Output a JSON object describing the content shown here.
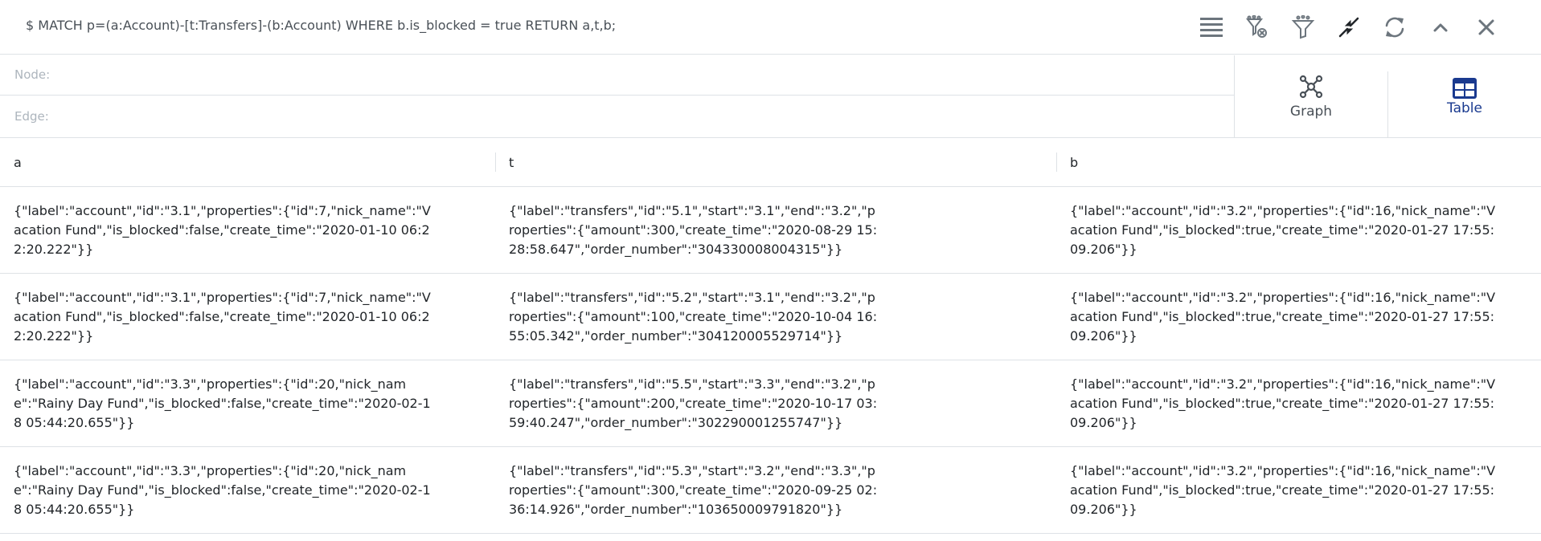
{
  "query": "$ MATCH p=(a:Account)-[t:Transfers]-(b:Account) WHERE b.is_blocked = true RETURN a,t,b;",
  "toolbar": {
    "icons": [
      "list-icon",
      "filter-remove-icon",
      "filter-icon",
      "collapse-icon",
      "refresh-icon",
      "chevron-up-icon",
      "close-icon"
    ]
  },
  "filters": {
    "node_placeholder": "Node:",
    "edge_placeholder": "Edge:"
  },
  "views": {
    "graph_label": "Graph",
    "table_label": "Table",
    "active": "Table",
    "active_color": "#1a3a8f"
  },
  "table": {
    "headers": [
      "a",
      "t",
      "b"
    ],
    "rows": [
      {
        "a": "{\"label\":\"account\",\"id\":\"3.1\",\"properties\":{\"id\":7,\"nick_name\":\"Vacation Fund\",\"is_blocked\":false,\"create_time\":\"2020-01-10 06:22:20.222\"}}",
        "t": "{\"label\":\"transfers\",\"id\":\"5.1\",\"start\":\"3.1\",\"end\":\"3.2\",\"properties\":{\"amount\":300,\"create_time\":\"2020-08-29 15:28:58.647\",\"order_number\":\"304330008004315\"}}",
        "b": "{\"label\":\"account\",\"id\":\"3.2\",\"properties\":{\"id\":16,\"nick_name\":\"Vacation Fund\",\"is_blocked\":true,\"create_time\":\"2020-01-27 17:55:09.206\"}}"
      },
      {
        "a": "{\"label\":\"account\",\"id\":\"3.1\",\"properties\":{\"id\":7,\"nick_name\":\"Vacation Fund\",\"is_blocked\":false,\"create_time\":\"2020-01-10 06:22:20.222\"}}",
        "t": "{\"label\":\"transfers\",\"id\":\"5.2\",\"start\":\"3.1\",\"end\":\"3.2\",\"properties\":{\"amount\":100,\"create_time\":\"2020-10-04 16:55:05.342\",\"order_number\":\"304120005529714\"}}",
        "b": "{\"label\":\"account\",\"id\":\"3.2\",\"properties\":{\"id\":16,\"nick_name\":\"Vacation Fund\",\"is_blocked\":true,\"create_time\":\"2020-01-27 17:55:09.206\"}}"
      },
      {
        "a": "{\"label\":\"account\",\"id\":\"3.3\",\"properties\":{\"id\":20,\"nick_name\":\"Rainy Day Fund\",\"is_blocked\":false,\"create_time\":\"2020-02-18 05:44:20.655\"}}",
        "t": "{\"label\":\"transfers\",\"id\":\"5.5\",\"start\":\"3.3\",\"end\":\"3.2\",\"properties\":{\"amount\":200,\"create_time\":\"2020-10-17 03:59:40.247\",\"order_number\":\"302290001255747\"}}",
        "b": "{\"label\":\"account\",\"id\":\"3.2\",\"properties\":{\"id\":16,\"nick_name\":\"Vacation Fund\",\"is_blocked\":true,\"create_time\":\"2020-01-27 17:55:09.206\"}}"
      },
      {
        "a": "{\"label\":\"account\",\"id\":\"3.3\",\"properties\":{\"id\":20,\"nick_name\":\"Rainy Day Fund\",\"is_blocked\":false,\"create_time\":\"2020-02-18 05:44:20.655\"}}",
        "t": "{\"label\":\"transfers\",\"id\":\"5.3\",\"start\":\"3.2\",\"end\":\"3.3\",\"properties\":{\"amount\":300,\"create_time\":\"2020-09-25 02:36:14.926\",\"order_number\":\"103650009791820\"}}",
        "b": "{\"label\":\"account\",\"id\":\"3.2\",\"properties\":{\"id\":16,\"nick_name\":\"Vacation Fund\",\"is_blocked\":true,\"create_time\":\"2020-01-27 17:55:09.206\"}}"
      }
    ]
  }
}
